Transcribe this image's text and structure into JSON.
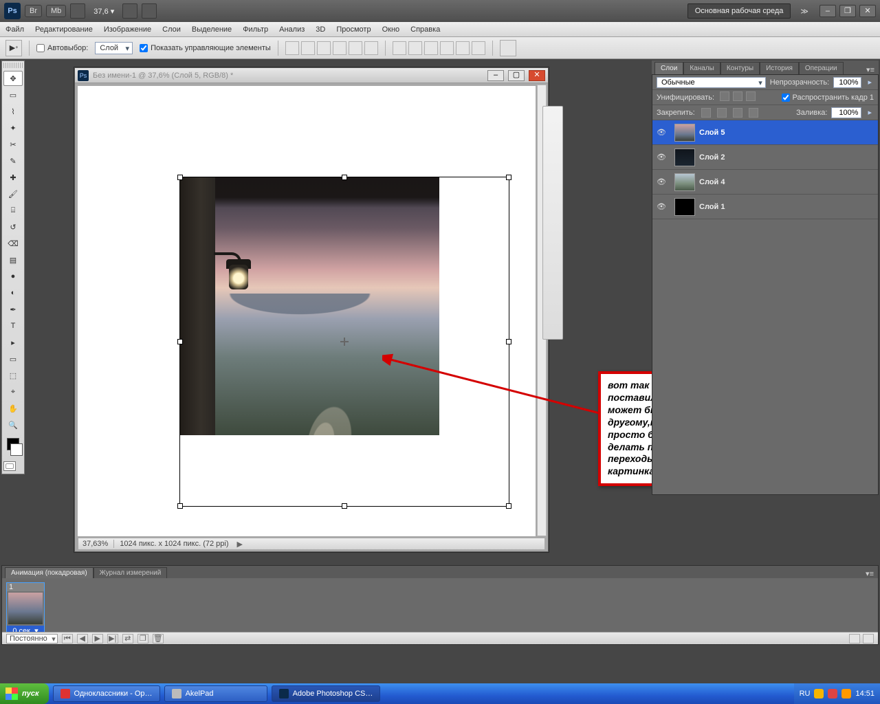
{
  "top": {
    "zoom_percent": "37,6",
    "workspace_label": "Основная рабочая среда",
    "chips": [
      "Br",
      "Mb"
    ]
  },
  "menu": {
    "items": [
      "Файл",
      "Редактирование",
      "Изображение",
      "Слои",
      "Выделение",
      "Фильтр",
      "Анализ",
      "3D",
      "Просмотр",
      "Окно",
      "Справка"
    ]
  },
  "options": {
    "auto_select_label": "Автовыбор:",
    "auto_select_value": "Слой",
    "show_controls_label": "Показать управляющие элементы"
  },
  "doc": {
    "title": "Без имени-1 @ 37,6% (Слой 5, RGB/8) *",
    "status_zoom": "37,63%",
    "status_dims": "1024 пикс. x 1024 пикс. (72 ppi)"
  },
  "panels": {
    "tabs": [
      "Слои",
      "Каналы",
      "Контуры",
      "История",
      "Операции"
    ],
    "blend_label_value": "Обычные",
    "opacity_label": "Непрозрачность:",
    "opacity_value": "100%",
    "unify_label": "Унифицировать:",
    "propagate_label": "Распространить кадр 1",
    "lock_label": "Закрепить:",
    "fill_label": "Заливка:",
    "fill_value": "100%",
    "layers": [
      {
        "name": "Слой 5",
        "thumb": "sky",
        "selected": true
      },
      {
        "name": "Слой 2",
        "thumb": "dark",
        "selected": false
      },
      {
        "name": "Слой 4",
        "thumb": "land",
        "selected": false
      },
      {
        "name": "Слой 1",
        "thumb": "black",
        "selected": false
      }
    ]
  },
  "callout": {
    "text": "вот так примерно я это поставила,но у вас это может быть совсем по другому,мы сейчас просто будем учиться делать плавные переходы между картинками..."
  },
  "animation": {
    "tabs": [
      "Анимация (покадровая)",
      "Журнал измерений"
    ],
    "frame_number": "1",
    "frame_time": "0 сек.",
    "loop_mode": "Постоянно"
  },
  "taskbar": {
    "start": "пуск",
    "tasks": [
      {
        "label": "Одноклассники - Op…",
        "kind": "ok",
        "active": false
      },
      {
        "label": "AkelPad",
        "kind": "akel",
        "active": false
      },
      {
        "label": "Adobe Photoshop CS…",
        "kind": "ps",
        "active": true
      }
    ],
    "lang": "RU",
    "clock": "14:51"
  }
}
